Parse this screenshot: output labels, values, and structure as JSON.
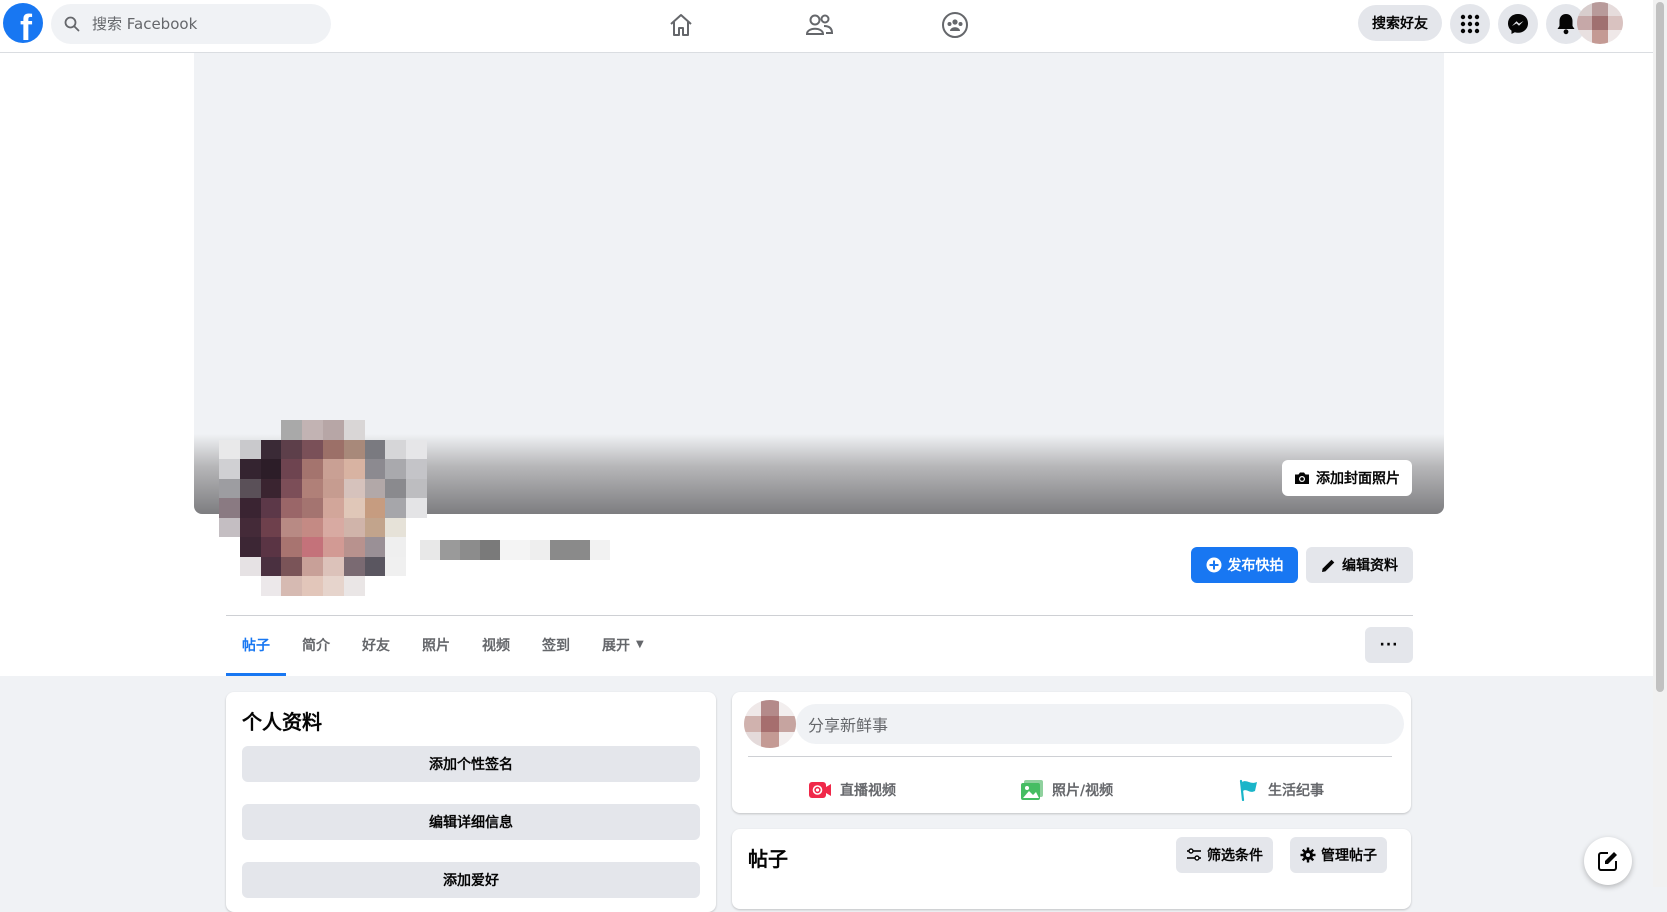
{
  "topbar": {
    "search_placeholder": "搜索 Facebook",
    "find_friends_label": "搜索好友",
    "nav_icons": [
      "home-icon",
      "friends-icon",
      "groups-icon"
    ],
    "right_icons": [
      "menu-grid-icon",
      "messenger-icon",
      "notifications-icon"
    ]
  },
  "cover": {
    "add_cover_label": "添加封面照片"
  },
  "actions": {
    "publish_story_label": "发布快拍",
    "edit_profile_label": "编辑资料"
  },
  "tabs": [
    {
      "label": "帖子",
      "active": true
    },
    {
      "label": "简介"
    },
    {
      "label": "好友"
    },
    {
      "label": "照片"
    },
    {
      "label": "视频"
    },
    {
      "label": "签到"
    },
    {
      "label": "展开",
      "has_caret": true
    }
  ],
  "more_label": "···",
  "intro": {
    "title": "个人资料",
    "buttons": [
      "添加个性签名",
      "编辑详细信息",
      "添加爱好"
    ]
  },
  "composer": {
    "placeholder": "分享新鲜事",
    "actions": [
      {
        "label": "直播视频",
        "icon": "live-video-icon",
        "color": "#f02849"
      },
      {
        "label": "照片/视频",
        "icon": "photo-video-icon",
        "color": "#45bd62"
      },
      {
        "label": "生活纪事",
        "icon": "life-event-icon",
        "color": "#1ab5c9"
      }
    ]
  },
  "posts": {
    "title": "帖子",
    "filter_label": "筛选条件",
    "manage_label": "管理帖子"
  },
  "colors": {
    "brand": "#1877f2",
    "background": "#f0f2f5",
    "button_grey": "#e4e6eb"
  }
}
